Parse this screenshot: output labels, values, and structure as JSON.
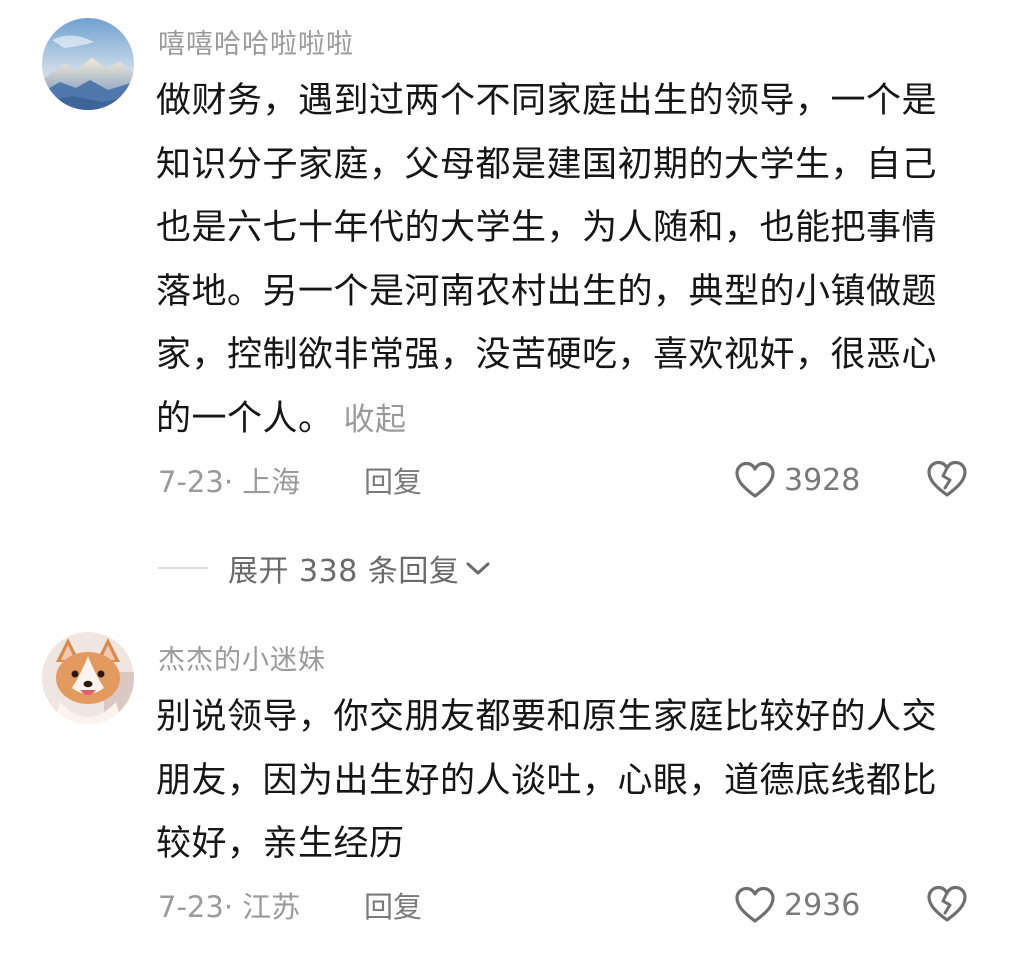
{
  "comments": [
    {
      "username": "嘻嘻哈哈啦啦啦",
      "avatar_icon": "mountain-landscape-avatar",
      "body": "做财务，遇到过两个不同家庭出生的领导，一个是知识分子家庭，父母都是建国初期的大学生，自己也是六七十年代的大学生，为人随和，也能把事情落地。另一个是河南农村出生的，典型的小镇做题家，控制欲非常强，没苦硬吃，喜欢视奸，很恶心的一个人。",
      "collapse_label": "收起",
      "date_location": "7-23· 上海",
      "reply_label": "回复",
      "like_count": "3928"
    },
    {
      "username": "杰杰的小迷妹",
      "avatar_icon": "corgi-dog-avatar",
      "body": "别说领导，你交朋友都要和原生家庭比较好的人交朋友，因为出生好的人谈吐，心眼，道德底线都比较好，亲生经历",
      "date_location": "7-23· 江苏",
      "reply_label": "回复",
      "like_count": "2936"
    }
  ],
  "expand_replies": {
    "label": "展开 338 条回复"
  },
  "colors": {
    "username": "#9a9a9a",
    "body_text": "#161616",
    "meta_text": "#9a9a9a",
    "icon_stroke": "#6f6f6f",
    "divider": "#dddddd"
  }
}
